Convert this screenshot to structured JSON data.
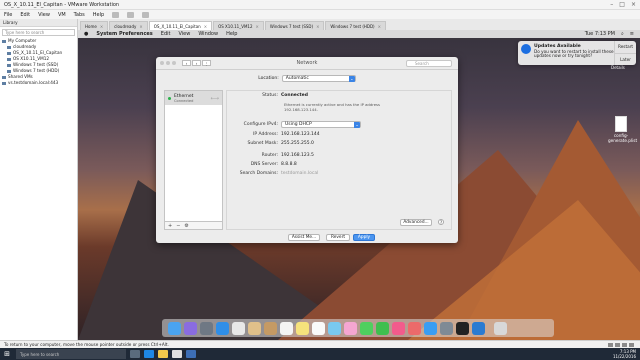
{
  "vmware": {
    "title": "OS_X_10.11_El_Capitan - VMware Workstation",
    "menu": [
      "File",
      "Edit",
      "View",
      "VM",
      "Tabs",
      "Help"
    ],
    "library": {
      "header": "Library",
      "search_placeholder": "Type here to search",
      "tree": [
        "My Computer",
        "cloudready",
        "OS_X_10.11_El_Capitan",
        "OS X10.11_VM12",
        "Windows 7 test (SSD)",
        "Windows 7 test (HDD)",
        "Shared VMs",
        "vs.testdomain.local:443"
      ]
    },
    "tabs": [
      "Home",
      "cloudready",
      "OS_X_10.11_El_Capitan",
      "OS X10.11_VM12",
      "Windows 7 test (SSD)",
      "Windows 7 test (HDD)"
    ],
    "status_text": "To return to your computer, move the mouse pointer outside or press Ctrl+Alt."
  },
  "mac": {
    "menubar": {
      "app": "System Preferences",
      "items": [
        "Edit",
        "View",
        "Window",
        "Help"
      ],
      "clock": "Tue 7:13 PM"
    },
    "notification": {
      "title": "Updates Available",
      "body": "Do you want to restart to install these updates now or try tonight?",
      "restart": "Restart",
      "later": "Later",
      "extra": "Details"
    },
    "desktop_file": "config-generate.plist"
  },
  "network": {
    "title": "Network",
    "search_placeholder": "Search",
    "location_label": "Location:",
    "location_value": "Automatic",
    "service": {
      "name": "Ethernet",
      "status": "Connected"
    },
    "status_label": "Status:",
    "status_value": "Connected",
    "status_note": "Ethernet is currently active and has the IP address 192.168.123.144.",
    "configure_label": "Configure IPv4:",
    "configure_value": "Using DHCP",
    "ip_label": "IP Address:",
    "ip_value": "192.168.123.144",
    "mask_label": "Subnet Mask:",
    "mask_value": "255.255.255.0",
    "router_label": "Router:",
    "router_value": "192.168.123.5",
    "dns_label": "DNS Server:",
    "dns_value": "8.8.8.8",
    "domains_label": "Search Domains:",
    "domains_value": "testdomain.local",
    "advanced": "Advanced...",
    "assist": "Assist Me...",
    "revert": "Revert",
    "apply": "Apply"
  },
  "taskbar": {
    "search_placeholder": "Type here to search",
    "time": "7:13 PM",
    "date": "11/22/2016"
  }
}
